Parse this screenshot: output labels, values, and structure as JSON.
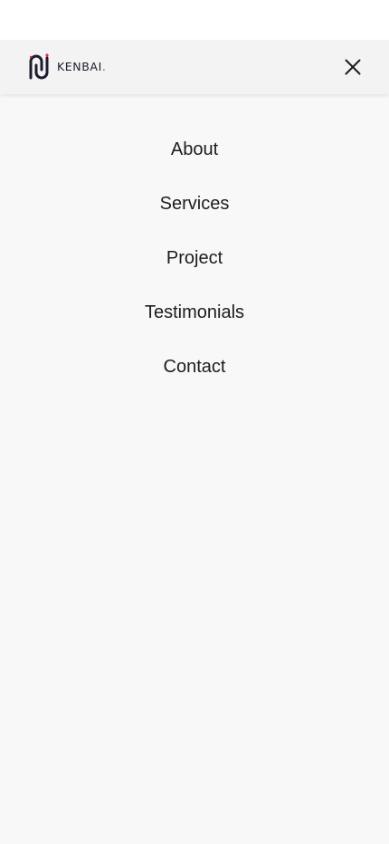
{
  "brand": {
    "logo_text": "KENBAI",
    "logo_dot": ".",
    "logo_icon": "kenbai-logo-icon",
    "accent_color": "#e0245e",
    "text_color": "#1e1b2e"
  },
  "header": {
    "close_icon": "close-icon"
  },
  "menu": {
    "items": [
      {
        "label": "About"
      },
      {
        "label": "Services"
      },
      {
        "label": "Project"
      },
      {
        "label": "Testimonials"
      },
      {
        "label": "Contact"
      }
    ]
  },
  "colors": {
    "header_bg": "#f3f3f3",
    "menu_bg": "#f8f8f8",
    "text": "#1d1d1f"
  }
}
